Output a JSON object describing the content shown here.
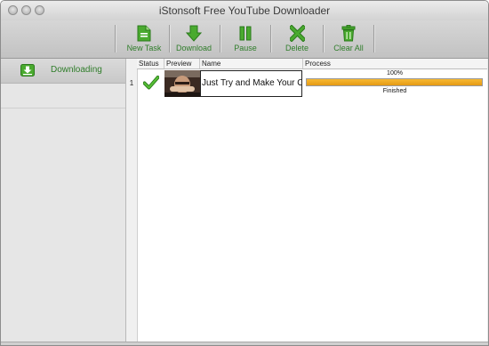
{
  "window": {
    "title": "iStonsoft Free YouTube Downloader"
  },
  "toolbar": {
    "new_task": "New Task",
    "download": "Download",
    "pause": "Pause",
    "delete": "Delete",
    "clear_all": "Clear All"
  },
  "sidebar": {
    "items": [
      {
        "label": "Downloading",
        "icon": "download-icon"
      }
    ]
  },
  "table": {
    "columns": [
      "Status",
      "Preview",
      "Name",
      "Process"
    ],
    "rows": [
      {
        "index": "1",
        "status": "check-icon",
        "name": "Just Try and Make Your Own",
        "progress_text": "100%",
        "progress": 1.0,
        "state": "Finished"
      }
    ]
  },
  "colors": {
    "accent_green": "#2f7d2a",
    "progress_orange": "#f0a41f"
  }
}
